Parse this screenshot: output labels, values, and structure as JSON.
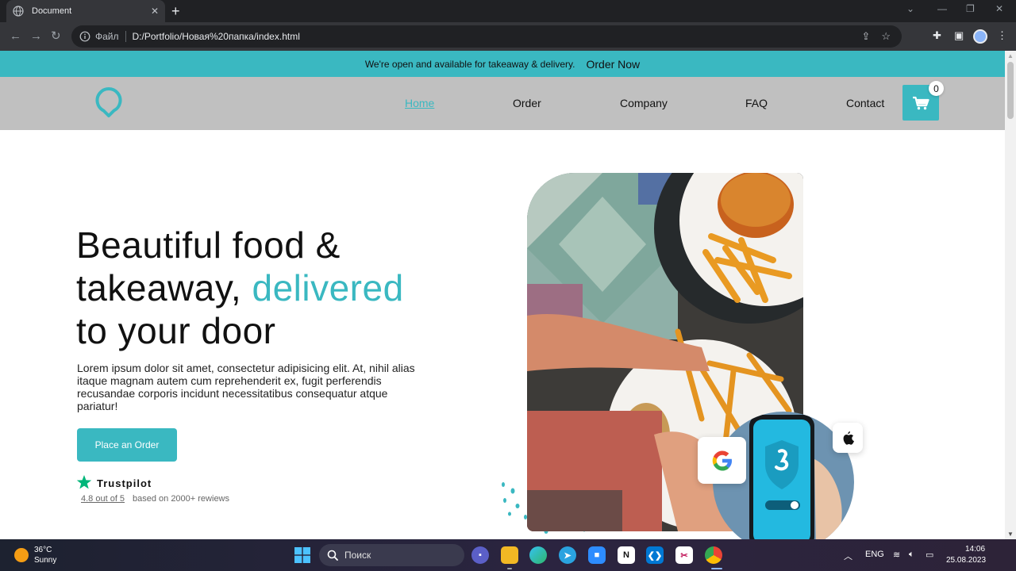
{
  "browser": {
    "tab_title": "Document",
    "tab_close": "✕",
    "new_tab": "+",
    "address_label": "Файл",
    "url": "D:/Portfolio/Новая%20папка/index.html"
  },
  "site": {
    "announcement": {
      "message": "We're open and available for takeaway & delivery.",
      "link": "Order Now"
    },
    "nav": {
      "links": [
        "Home",
        "Order",
        "Company",
        "FAQ",
        "Contact"
      ],
      "active": "Home",
      "cart_count": "0"
    },
    "hero": {
      "title_part1": "Beautiful food &",
      "title_part2a": "takeaway, ",
      "title_accent": "delivered",
      "title_part3": "to your door",
      "description": "Lorem ipsum dolor sit amet, consectetur adipisicing elit. At, nihil alias itaque magnam autem cum reprehenderit ex, fugit perferendis recusandae corporis incidunt necessitatibus consequatur atque pariatur!",
      "cta": "Place an Order",
      "trustpilot": {
        "name": "Trustpilot",
        "rating": "4.8 out of 5",
        "based_on": "based on 2000+ rewiews"
      }
    },
    "colors": {
      "accent": "#3ab8c1",
      "nav_bg": "#c0c0c0",
      "trustpilot_green": "#00b67a"
    }
  },
  "taskbar": {
    "weather_temp": "36°C",
    "weather_condition": "Sunny",
    "search_placeholder": "Поиск",
    "language": "ENG",
    "time": "14:06",
    "date": "25.08.2023",
    "apps": [
      "start-icon",
      "teams-icon",
      "file-explorer-icon",
      "edge-icon",
      "telegram-icon",
      "zoom-icon",
      "notion-icon",
      "vscode-icon",
      "snipping-tool-icon",
      "chrome-icon"
    ]
  }
}
